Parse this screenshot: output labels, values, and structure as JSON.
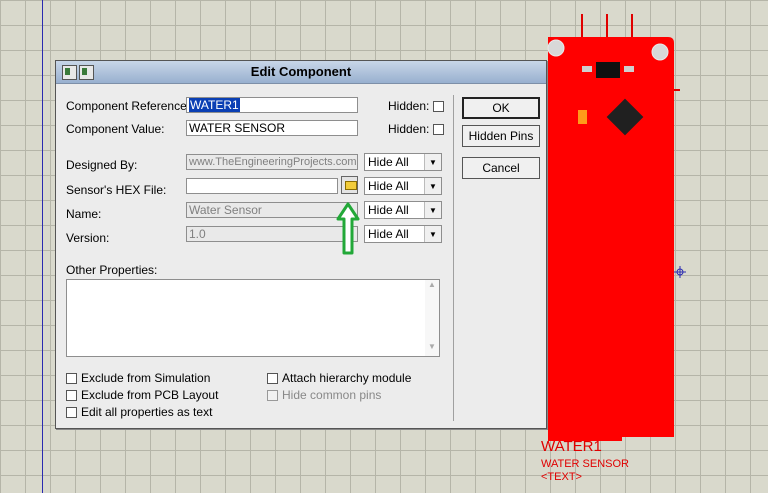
{
  "canvas": {
    "component": {
      "ref_label": "WATER1",
      "value_label": "WATER SENSOR",
      "text_label": "<TEXT>",
      "color": "#ff0000"
    }
  },
  "dialog": {
    "title": "Edit Component",
    "fields": {
      "component_reference": {
        "label": "Component Reference:",
        "value": "WATER1",
        "hidden_label": "Hidden:"
      },
      "component_value": {
        "label": "Component Value:",
        "value": "WATER SENSOR",
        "hidden_label": "Hidden:"
      },
      "designed_by": {
        "label": "Designed By:",
        "value": "www.TheEngineeringProjects.com",
        "visibility": "Hide All"
      },
      "hex_file": {
        "label": "Sensor's HEX File:",
        "value": "",
        "visibility": "Hide All"
      },
      "name": {
        "label": "Name:",
        "value": "Water Sensor",
        "visibility": "Hide All"
      },
      "version": {
        "label": "Version:",
        "value": "1.0",
        "visibility": "Hide All"
      }
    },
    "other_properties_label": "Other Properties:",
    "checkboxes": {
      "exclude_simulation": "Exclude from Simulation",
      "exclude_pcb": "Exclude from PCB Layout",
      "edit_all": "Edit all properties as text",
      "attach_hierarchy": "Attach hierarchy module",
      "hide_common_pins": "Hide common pins"
    },
    "buttons": {
      "ok": "OK",
      "hidden_pins": "Hidden Pins",
      "cancel": "Cancel"
    },
    "accent_color": "#0a3fb4",
    "annotation_arrow_color": "#22a838"
  }
}
